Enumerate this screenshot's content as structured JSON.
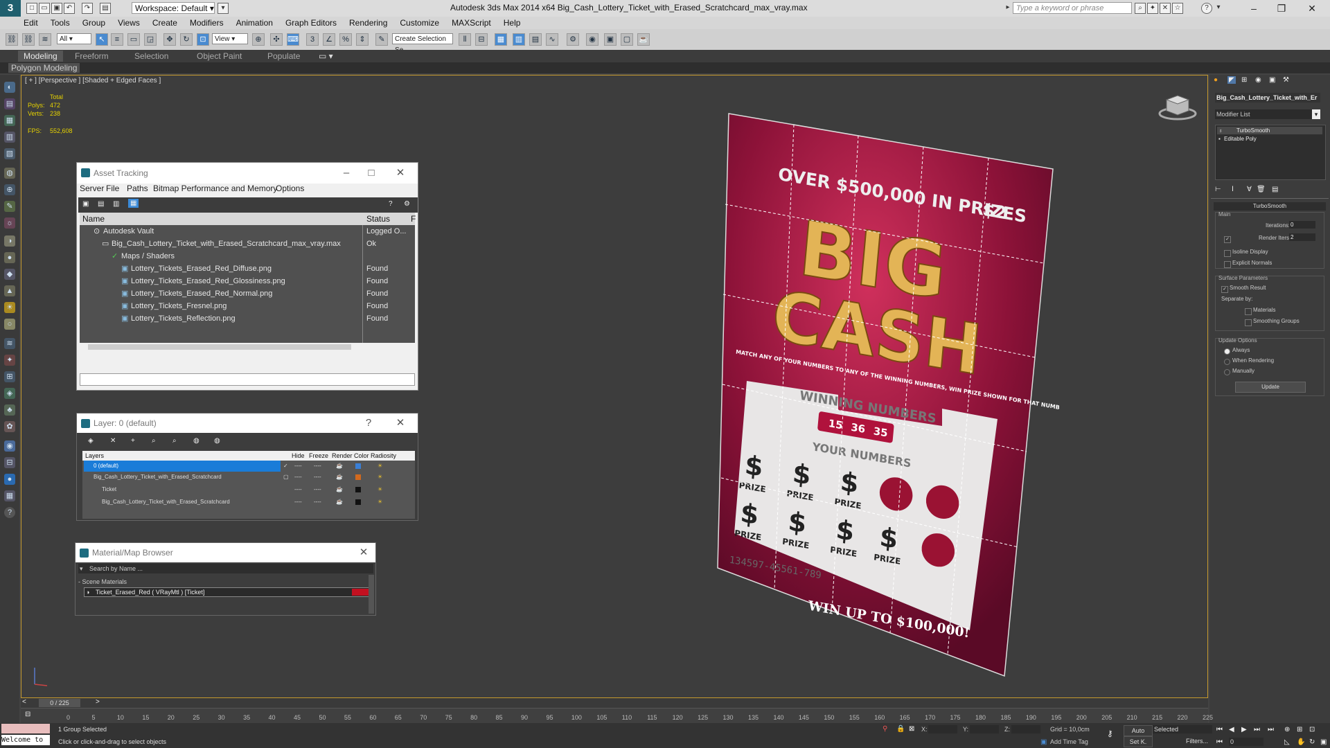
{
  "titlebar": {
    "workspace": "Workspace: Default",
    "app_title": "Autodesk 3ds Max  2014 x64     Big_Cash_Lottery_Ticket_with_Erased_Scratchcard_max_vray.max",
    "search_placeholder": "Type a keyword or phrase"
  },
  "menu": [
    "Edit",
    "Tools",
    "Group",
    "Views",
    "Create",
    "Modifiers",
    "Animation",
    "Graph Editors",
    "Rendering",
    "Customize",
    "MAXScript",
    "Help"
  ],
  "toolbar": {
    "filter_all": "All",
    "ref_coord": "View",
    "named_selection": "Create Selection Se"
  },
  "ribbon": {
    "tabs": [
      "Modeling",
      "Freeform",
      "Selection",
      "Object Paint",
      "Populate"
    ],
    "subtitle": "Polygon Modeling"
  },
  "viewport": {
    "label": "[ + ] [Perspective ] [Shaded + Edged Faces ]",
    "stats": {
      "total_label": "Total",
      "polys_label": "Polys:",
      "polys": "472",
      "verts_label": "Verts:",
      "verts": "238",
      "fps_label": "FPS:",
      "fps": "552,608"
    }
  },
  "ticket": {
    "prizes_line": "OVER $500,000 IN PRIZES",
    "price": "$2",
    "big": "BIG",
    "cash": "CASH",
    "rules": "MATCH ANY OF YOUR NUMBERS TO ANY OF THE WINNING NUMBERS, WIN PRIZE SHOWN FOR THAT NUMBER.",
    "winning_numbers": "WINNING NUMBERS",
    "win_nums": [
      "15",
      "36",
      "35"
    ],
    "your_numbers": "YOUR NUMBERS",
    "prize_word": "PRIZE",
    "serial": "134597-45561-789",
    "win_up_to": "WIN UP TO $100,000!"
  },
  "asset_tracking": {
    "title": "Asset Tracking",
    "menus": [
      "Server",
      "File",
      "Paths",
      "Bitmap Performance and Memory",
      "Options"
    ],
    "col_name": "Name",
    "col_status": "Status",
    "col_extra": "F",
    "rows": [
      {
        "name": "Autodesk Vault",
        "status": "Logged O..."
      },
      {
        "name": "Big_Cash_Lottery_Ticket_with_Erased_Scratchcard_max_vray.max",
        "status": "Ok"
      },
      {
        "name": "Maps / Shaders",
        "status": ""
      },
      {
        "name": "Lottery_Tickets_Erased_Red_Diffuse.png",
        "status": "Found"
      },
      {
        "name": "Lottery_Tickets_Erased_Red_Glossiness.png",
        "status": "Found"
      },
      {
        "name": "Lottery_Tickets_Erased_Red_Normal.png",
        "status": "Found"
      },
      {
        "name": "Lottery_Tickets_Fresnel.png",
        "status": "Found"
      },
      {
        "name": "Lottery_Tickets_Reflection.png",
        "status": "Found"
      }
    ]
  },
  "layer_dialog": {
    "title": "Layer: 0 (default)",
    "help": "?",
    "cols": {
      "layers": "Layers",
      "hide": "Hide",
      "freeze": "Freeze",
      "render": "Render",
      "color": "Color",
      "radiosity": "Radiosity"
    },
    "rows": [
      {
        "name": "0 (default)",
        "color": "#3a7fd6"
      },
      {
        "name": "Big_Cash_Lottery_Ticket_with_Erased_Scratchcard",
        "color": "#d2691e"
      },
      {
        "name": "Ticket",
        "color": "#111111"
      },
      {
        "name": "Big_Cash_Lottery_Ticket_with_Erased_Scratchcard",
        "color": "#111111"
      }
    ],
    "dash": "----"
  },
  "material_browser": {
    "title": "Material/Map Browser",
    "search_placeholder": "Search by Name ...",
    "section": "- Scene Materials",
    "item": "Ticket_Erased_Red  ( VRayMtl ) [Ticket]"
  },
  "command_panel": {
    "object_name": "Big_Cash_Lottery_Ticket_with_Er",
    "modifier_list": "Modifier List",
    "stack": [
      "TurboSmooth",
      "Editable Poly"
    ],
    "rollout_title": "TurboSmooth",
    "main_label": "Main",
    "iterations_label": "Iterations:",
    "iterations": "0",
    "render_iters_label": "Render Iters:",
    "render_iters": "2",
    "isoline": "Isoline Display",
    "explicit_normals": "Explicit Normals",
    "surface_params": "Surface Parameters",
    "smooth_result": "Smooth Result",
    "separate_by": "Separate by:",
    "materials": "Materials",
    "smoothing_groups": "Smoothing Groups",
    "update_options": "Update Options",
    "always": "Always",
    "when_rendering": "When Rendering",
    "manually": "Manually",
    "update_btn": "Update"
  },
  "timeline": {
    "frame": "0 / 225",
    "ticks": [
      "0",
      "5",
      "10",
      "15",
      "20",
      "25",
      "30",
      "35",
      "40",
      "45",
      "50",
      "55",
      "60",
      "65",
      "70",
      "75",
      "80",
      "85",
      "90",
      "95",
      "100",
      "105",
      "110",
      "115",
      "120",
      "125",
      "130",
      "135",
      "140",
      "145",
      "150",
      "155",
      "160",
      "165",
      "170",
      "175",
      "180",
      "185",
      "190",
      "195",
      "200",
      "205",
      "210",
      "215",
      "220",
      "225"
    ]
  },
  "status": {
    "welcome": "Welcome to",
    "selection": "1 Group Selected",
    "hint": "Click or click-and-drag to select objects",
    "x_label": "X:",
    "y_label": "Y:",
    "z_label": "Z:",
    "grid": "Grid = 10,0cm",
    "auto": "Auto",
    "selected": "Selected",
    "set_k": "Set K.",
    "filters": "Filters...",
    "add_time_tag": "Add Time Tag",
    "frame_field": "0"
  }
}
